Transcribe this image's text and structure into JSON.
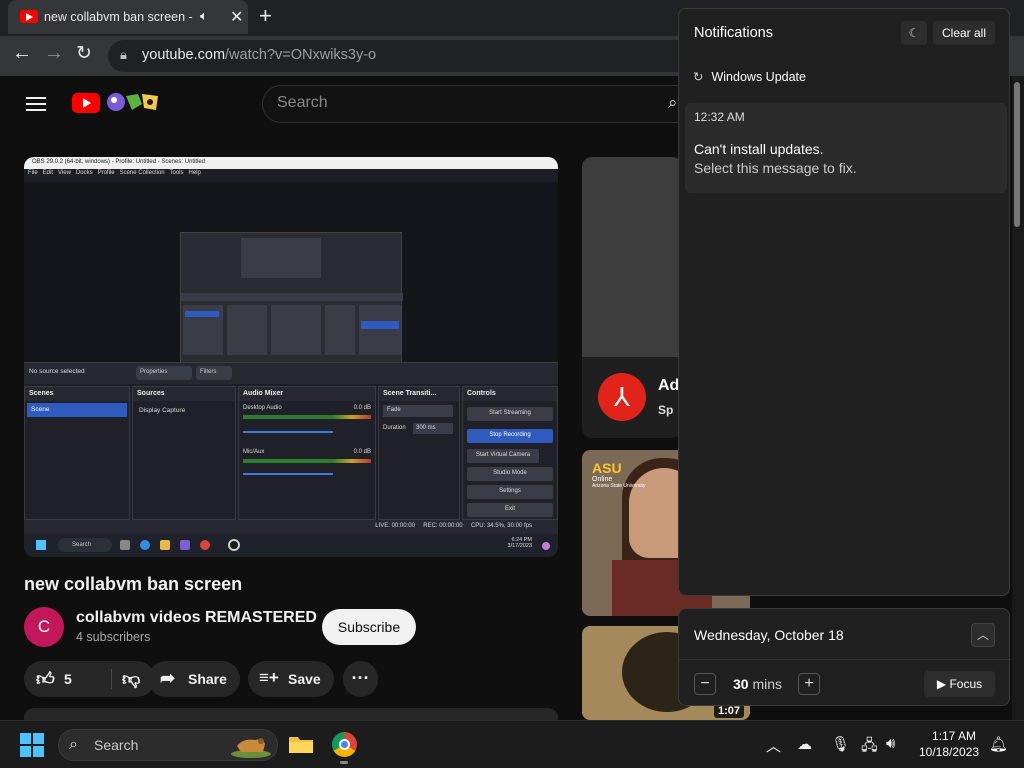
{
  "browser": {
    "tab_title": "new collabvm ban screen - YouTube",
    "url_host": "youtube.com",
    "url_path": "/watch?v=ONxwiks3y-o"
  },
  "youtube": {
    "search_placeholder": "Search",
    "video": {
      "title": "new collabvm ban screen",
      "channel_name": "collabvm videos REMASTERED",
      "channel_initial": "C",
      "subscribers": "4 subscribers",
      "subscribe_label": "Subscribe",
      "like_count": "5",
      "share_label": "Share",
      "save_label": "Save",
      "more_label": "···"
    },
    "obs": {
      "window_title": "OBS 29.0.2 (64-bit, windows) - Profile: Untitled - Scenes: Untitled",
      "menu": "File   Edit   View   Docks   Profile   Scene Collection   Tools   Help",
      "no_source": "No source selected",
      "properties": "Properties",
      "filters": "Filters",
      "docks": {
        "scenes": "Scenes",
        "scene_item": "Scene",
        "sources": "Sources",
        "source_item": "Display Capture",
        "audio_mixer": "Audio Mixer",
        "desktop_audio": "Desktop Audio",
        "mic_aux": "Mic/Aux",
        "db_value": "0.0 dB",
        "transitions": "Scene Transiti...",
        "fade": "Fade",
        "duration_label": "Duration",
        "duration_value": "300 ms",
        "controls": "Controls"
      },
      "controls": [
        "Start Streaming",
        "Stop Recording",
        "Start Virtual Camera",
        "Studio Mode",
        "Settings",
        "Exit"
      ],
      "status": "LIVE: 00:00:00     REC: 00:00:00     CPU: 34.5%, 30.00 fps",
      "taskbar_search": "Search",
      "taskbar_time": "6:24 PM",
      "taskbar_date": "3/17/2023"
    },
    "sidebar": {
      "ad_title": "Ad",
      "ad_sub": "Sp",
      "asu_logo": "ASU",
      "asu_online": "Online",
      "asu_name": "Arizona State University",
      "video_duration": "1:07"
    }
  },
  "notifications": {
    "header": "Notifications",
    "clear_all": "Clear all",
    "group": "Windows Update",
    "time": "12:32 AM",
    "title": "Can't install updates.",
    "body": "Select this message to fix."
  },
  "calendar": {
    "date": "Wednesday, October 18",
    "focus_value": "30",
    "focus_unit": "mins",
    "focus_label": "Focus"
  },
  "taskbar": {
    "search_label": "Search",
    "time": "1:17 AM",
    "date": "10/18/2023"
  },
  "colors": {
    "youtube_red": "#ff0000",
    "obs_selection": "#2e5bbd",
    "windows_accent": "#4cc2ff"
  }
}
